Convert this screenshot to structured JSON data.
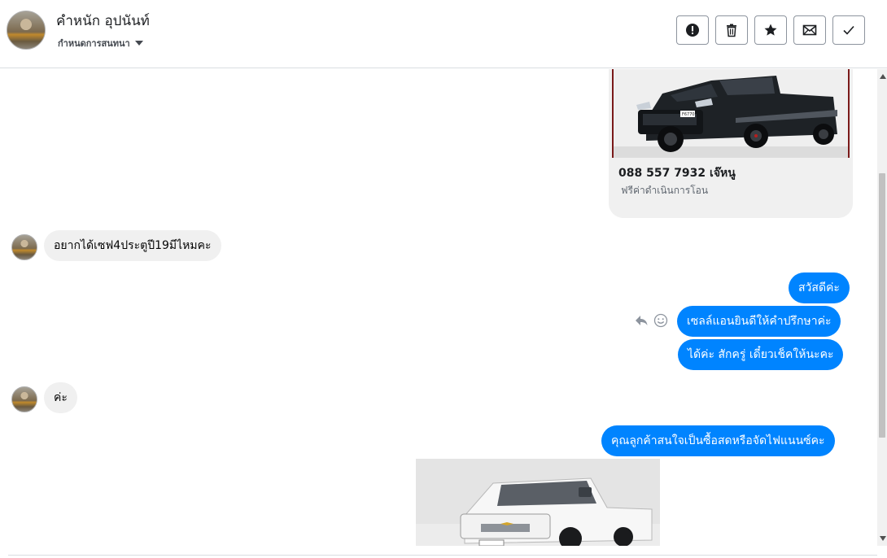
{
  "header": {
    "contact_name": "คำหนัก อุปนันท์",
    "contact_sub": "กำหนดการสนทนา",
    "actions": [
      {
        "icon": "alert-icon"
      },
      {
        "icon": "trash-icon"
      },
      {
        "icon": "star-icon"
      },
      {
        "icon": "envelope-icon"
      },
      {
        "icon": "check-icon"
      }
    ]
  },
  "card": {
    "title": "088 557 7932 เจ๊หนู",
    "subtitle": "ฟรีค่าดำเนินการโอน",
    "plate_text": "F6770"
  },
  "messages": [
    {
      "direction": "in",
      "text": "อยากได้เซฟ4ประตูปี19มีไหมคะ"
    },
    {
      "direction": "out",
      "text": "สวัสดีค่ะ"
    },
    {
      "direction": "out",
      "text": "เซลล์แอนยินดีให้คำปรึกษาค่ะ"
    },
    {
      "direction": "out",
      "text": "ได้ค่ะ  สักครู่ เดี๋ยวเช็คให้นะคะ"
    },
    {
      "direction": "in",
      "text": "ค่ะ"
    },
    {
      "direction": "out",
      "text": "คุณลูกค้าสนใจเป็นซื้อสดหรือจัดไฟแนนซ์คะ"
    }
  ],
  "colors": {
    "outgoing_bubble": "#0084ff",
    "incoming_bubble": "#f0f0f0"
  }
}
